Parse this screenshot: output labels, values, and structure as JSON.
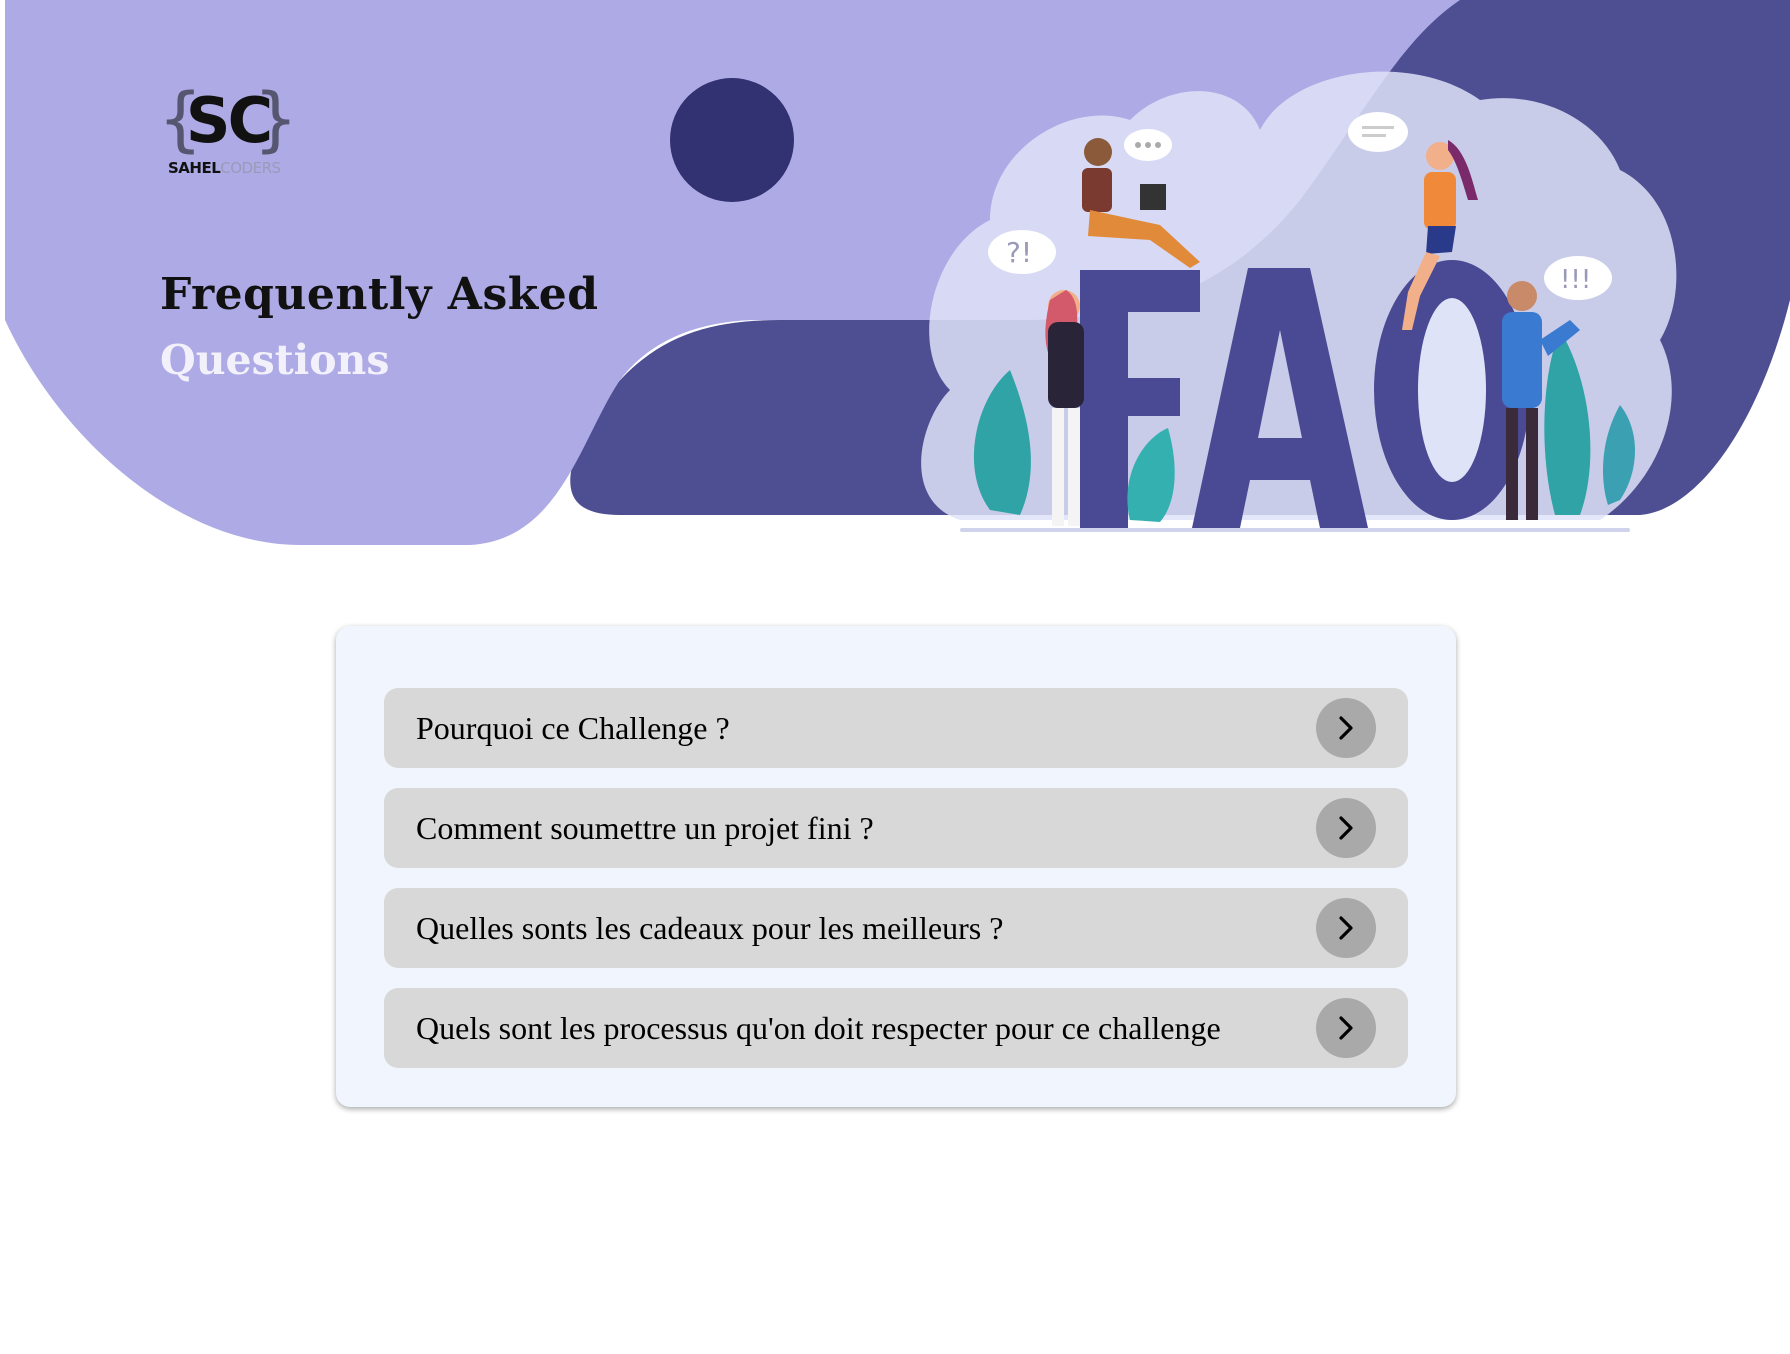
{
  "brand": {
    "logo_letters": "SC",
    "name_bold": "SAHEL",
    "name_light": "CODERS"
  },
  "hero": {
    "title": "Frequently Asked",
    "subtitle": "Questions",
    "illustration_text": "FAQ",
    "bubble_texts": [
      "?!",
      "!!!"
    ]
  },
  "faq": {
    "items": [
      {
        "question": "Pourquoi ce Challenge ?",
        "icon": "chevron-right-icon"
      },
      {
        "question": "Comment soumettre un projet fini ?",
        "icon": "chevron-right-icon"
      },
      {
        "question": "Quelles sonts les cadeaux pour les meilleurs ?",
        "icon": "chevron-right-icon"
      },
      {
        "question": "Quels sont les processus qu'on doit respecter pour ce challenge",
        "icon": "chevron-right-icon"
      }
    ]
  },
  "colors": {
    "hero_light": "#adaae5",
    "hero_dark": "#4e4e92",
    "circle": "#323171",
    "card_bg": "#f1f6fe",
    "item_bg": "#d8d8d8",
    "toggle_bg": "#a9a9a9"
  }
}
